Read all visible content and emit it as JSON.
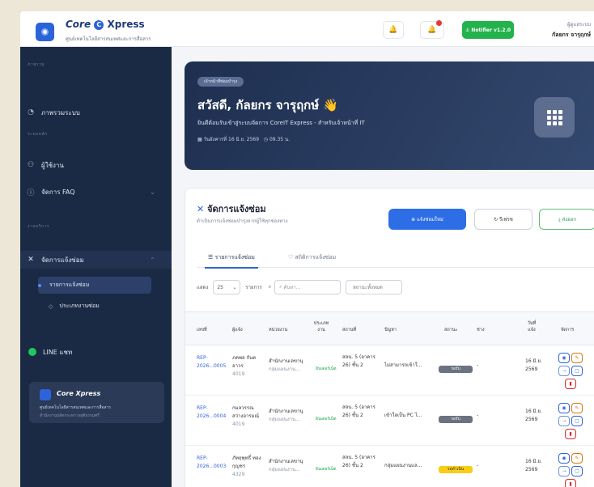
{
  "app": {
    "brand_core": "Core",
    "brand_x": "Xpress",
    "brand_subtitle": "ศูนย์เทคโนโลยีสารสนเทศและการสื่อสาร"
  },
  "topbar": {
    "notify_label": "⚓ Notifier v1.2.0",
    "user_role": "ผู้ดูแลระบบ",
    "user_name": "กัลยกร จารุฤกษ์"
  },
  "sidebar": {
    "sections": [
      "ภาพรวม",
      "ระบบหลัก",
      "งานบริการ"
    ],
    "items": [
      {
        "label": "ภาพรวมระบบ",
        "icon": "gauge-icon"
      },
      {
        "label": "ผู้ใช้งาน",
        "icon": "users-icon"
      },
      {
        "label": "จัดการ FAQ",
        "icon": "question-icon"
      },
      {
        "label": "จัดการแจ้งซ่อม",
        "icon": "tools-icon"
      },
      {
        "label": "LINE แชท",
        "icon": "line-icon"
      }
    ],
    "subitems": [
      {
        "label": "รายการแจ้งซ่อม"
      },
      {
        "label": "ประเภทงานซ่อม"
      }
    ],
    "promo": {
      "brand": "Core Xpress",
      "line1": "ศูนย์เทคโนโลยีสารสนเทศและการสื่อสาร",
      "line2": "สำนักงานปลัดกระทรวงยุติธรรมศรี"
    }
  },
  "hero": {
    "pill": "เจ้าหน้าที่ซ่อมบำรุง",
    "greeting": "สวัสดี, กัลยกร จารุฤกษ์",
    "wave": "👋",
    "desc": "ยินดีต้อนรับเข้าสู่ระบบจัดการ CoreIT Express - สำหรับเจ้าหน้าที่ IT",
    "date": "▦ วันอังคารที่ 16 มิ.ย. 2569",
    "time": "◷ 09.35 น."
  },
  "card": {
    "title": "จัดการแจ้งซ่อม",
    "subtitle": "ดำเนินการแจ้งซ่อมบำรุงจากผู้ใช้ทุกช่องทาง",
    "btn_new": "⊕ แจ้งซ่อมใหม่",
    "btn_refresh": "↻ รีเฟรช",
    "btn_export": "⤓ ส่งออก",
    "tab1": "☰ รายการแจ้งซ่อม",
    "tab2": "♡ สถิติการแจ้งซ่อม",
    "show_label": "แสดง",
    "page_size": "25",
    "page_unit": "รายการ",
    "search_placeholder": "ค้นหา...",
    "status_filter": "สถานะทั้งหมด",
    "headers": [
      "เลขที่",
      "ผู้แจ้ง",
      "หน่วยงาน",
      "ประเภท งาน",
      "สถานที่",
      "ปัญหา",
      "สถานะ",
      "ช่าง",
      "วันที่ แจ้ง",
      "จัดการ"
    ],
    "rows": [
      {
        "id": "REP-2026...0005",
        "reporter": "ภคพล กันต อาวร",
        "ext": "4019",
        "dept": "สำนักงานเลขานุ",
        "dept2": "กลุ่มแผนงาน...",
        "type": "อินเตอร์เน็ต",
        "loc": "สลน. 5 (อาคาร 26) ชั้น 2",
        "problem": "ไม่สามารถเข้าใ...",
        "status": "รอรับ",
        "tech": "-",
        "date": "16 มิ.ย. 2569"
      },
      {
        "id": "REP-2026...0004",
        "reporter": "กมลวรรณ สว่างอารมณ์",
        "ext": "4019",
        "dept": "สำนักงานเลขานุ",
        "dept2": "กลุ่มแผนงาน...",
        "type": "อินเตอร์เน็ต",
        "loc": "สลน. 5 (อาคาร 26) ชั้น 2",
        "problem": "เข้าใลเป็น PC ไ...",
        "status": "รอรับ",
        "tech": "-",
        "date": "16 มิ.ย. 2569"
      },
      {
        "id": "REP-2026...0003",
        "reporter": "ภัทฤพุทธิ์ ทอง กุญชร",
        "ext": "4329",
        "dept": "สำนักงานเลขานุ",
        "dept2": "กลุ่มแผนงาน...",
        "type": "อินเตอร์เน็ต",
        "loc": "สลน. 5 (อาคาร 26) ชั้น 2",
        "problem": "กลุ่มแผนงานแล...",
        "status": "รอดำเนิน",
        "tech": "-",
        "date": "16 มิ.ย. 2569"
      }
    ]
  }
}
